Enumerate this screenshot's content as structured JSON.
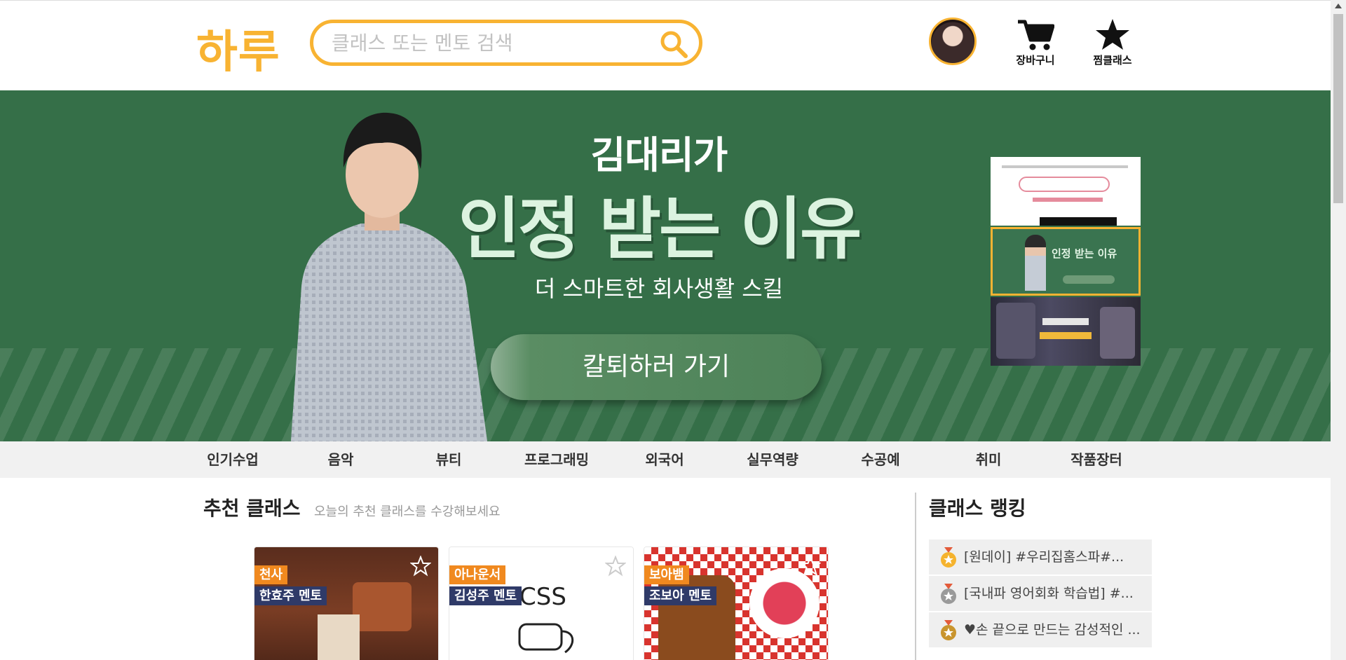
{
  "header": {
    "logo": "하루",
    "search_placeholder": "클래스 또는 멘토 검색",
    "cart_label": "장바구니",
    "wishlist_label": "찜클래스"
  },
  "banner": {
    "line1": "김대리가",
    "line2": "인정 받는 이유",
    "line3": "더 스마트한 회사생활 스킬",
    "cta": "칼퇴하러 가기",
    "thumbnails": [
      "thumb-1",
      "thumb-2-active",
      "thumb-3"
    ]
  },
  "categories": [
    "인기수업",
    "음악",
    "뷰티",
    "프로그래밍",
    "외국어",
    "실무역량",
    "수공예",
    "취미",
    "작품장터"
  ],
  "recommended": {
    "title": "추천 클래스",
    "subtitle": "오늘의 추천 클래스를 수강해보세요",
    "cards": [
      {
        "nickname": "천사",
        "mentor": "한효주 멘토"
      },
      {
        "nickname": "아나운서",
        "mentor": "김성주 멘토"
      },
      {
        "nickname": "보아뱀",
        "mentor": "조보아 멘토"
      }
    ]
  },
  "ranking": {
    "title": "클래스 랭킹",
    "items": [
      {
        "medal": "gold",
        "text": "[원데이] #우리집홈스파#..."
      },
      {
        "medal": "silver",
        "text": "[국내파 영어회화 학습법] #..."
      },
      {
        "medal": "bronze",
        "text": "♥손 끝으로 만드는 감성적인 ..."
      }
    ]
  },
  "colors": {
    "accent": "#f8b332",
    "banner_bg": "#356f48",
    "tag_orange": "#f0891f",
    "tag_navy": "#2f3a68"
  }
}
